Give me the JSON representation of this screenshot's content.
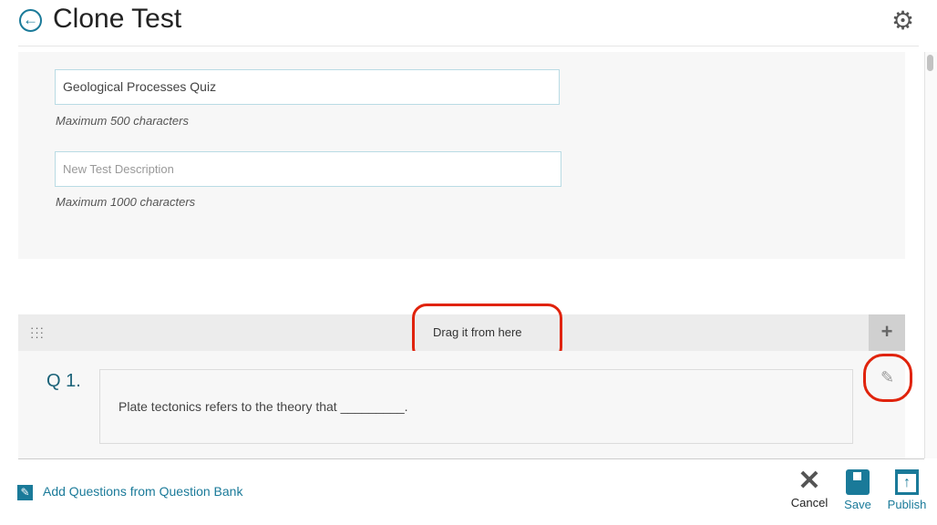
{
  "header": {
    "title": "Clone Test",
    "back_icon": "arrow-left-circle-icon",
    "settings_icon": "gear-icon"
  },
  "form": {
    "name_value": "Geological Processes Quiz",
    "name_hint": "Maximum 500 characters",
    "description_placeholder": "New Test Description",
    "description_hint": "Maximum 1000 characters"
  },
  "question_bar": {
    "drag_label": "Drag it from here"
  },
  "questions": [
    {
      "number": "Q 1.",
      "text": "Plate tectonics refers to the theory that _________."
    }
  ],
  "footer": {
    "add_questions": "Add Questions from Question Bank",
    "cancel": "Cancel",
    "save": "Save",
    "publish": "Publish"
  },
  "colors": {
    "accent": "#1a7a99",
    "highlight": "#e0230c"
  }
}
